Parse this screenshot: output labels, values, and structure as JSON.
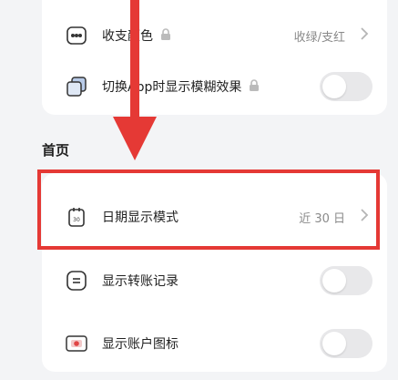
{
  "top_card": {
    "color_row": {
      "label": "收支颜色",
      "value": "收绿/支红"
    },
    "blur_row": {
      "label": "切换App时显示模糊效果"
    }
  },
  "home_section": {
    "title": "首页",
    "date_row": {
      "label": "日期显示模式",
      "value": "近 30 日"
    },
    "transfer_row": {
      "label": "显示转账记录"
    },
    "account_icon_row": {
      "label": "显示账户图标"
    }
  },
  "icons": {
    "color": "color-palette-icon",
    "blur": "blur-window-icon",
    "date": "calendar-icon",
    "transfer": "transfer-record-icon",
    "account": "account-card-icon",
    "lock": "lock-icon",
    "chevron": "chevron-right-icon"
  },
  "accent": "#e53935"
}
